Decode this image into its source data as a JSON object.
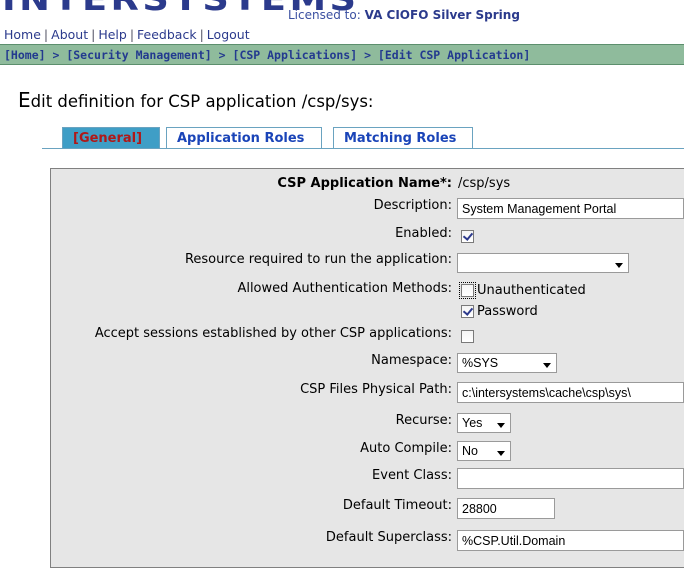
{
  "header": {
    "logo_text": "INTERSYSTEMS",
    "license_prefix": "Licensed to:",
    "license_holder": "VA CIOFO Silver Spring",
    "nav": [
      "Home",
      "About",
      "Help",
      "Feedback",
      "Logout"
    ]
  },
  "breadcrumb": [
    "[Home]",
    "[Security Management]",
    "[CSP Applications]",
    "[Edit CSP Application]"
  ],
  "breadcrumb_sep": " > ",
  "page": {
    "title_first_letter": "E",
    "title_rest": "dit definition for CSP application /csp/sys:"
  },
  "tabs": [
    {
      "label": "[General]",
      "active": true
    },
    {
      "label": "Application Roles",
      "active": false
    },
    {
      "label": "Matching Roles",
      "active": false
    }
  ],
  "form": {
    "app_name": {
      "label": "CSP Application Name*:",
      "value": "/csp/sys"
    },
    "description": {
      "label": "Description:",
      "value": "System Management Portal"
    },
    "enabled": {
      "label": "Enabled:",
      "checked": true
    },
    "resource": {
      "label": "Resource required to run the application:",
      "value": ""
    },
    "auth_methods": {
      "label": "Allowed Authentication Methods:",
      "options": [
        {
          "label": "Unauthenticated",
          "checked": false
        },
        {
          "label": "Password",
          "checked": true
        }
      ]
    },
    "accept_sessions": {
      "label": "Accept sessions established by other CSP applications:",
      "checked": false
    },
    "namespace": {
      "label": "Namespace:",
      "value": "%SYS"
    },
    "physical_path": {
      "label": "CSP Files Physical Path:",
      "value": "c:\\intersystems\\cache\\csp\\sys\\"
    },
    "recurse": {
      "label": "Recurse:",
      "value": "Yes"
    },
    "auto_compile": {
      "label": "Auto Compile:",
      "value": "No"
    },
    "event_class": {
      "label": "Event Class:",
      "value": ""
    },
    "default_timeout": {
      "label": "Default Timeout:",
      "value": "28800"
    },
    "default_superclass": {
      "label": "Default Superclass:",
      "value": "%CSP.Util.Domain"
    }
  }
}
